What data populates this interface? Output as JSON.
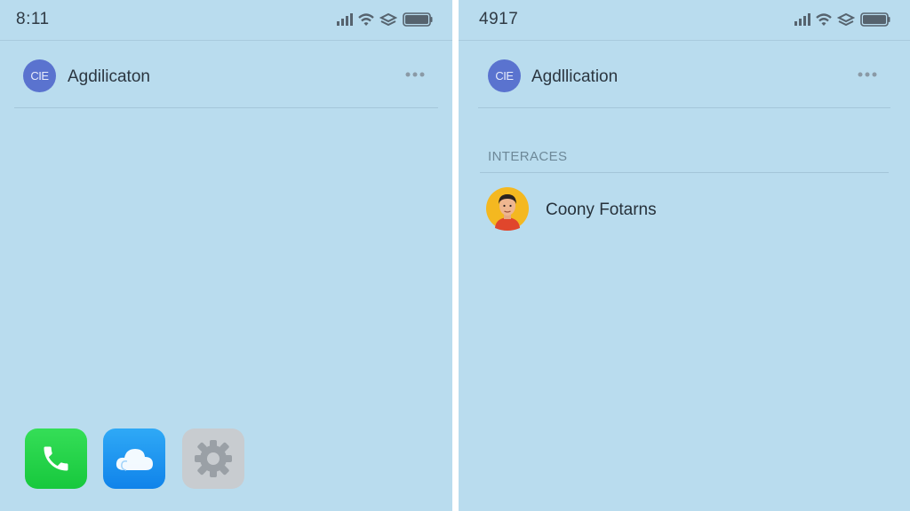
{
  "left_screen": {
    "status": {
      "time": "8:11"
    },
    "header": {
      "badge": "CIE",
      "title": "Agdilicaton"
    },
    "dock": [
      {
        "name": "phone",
        "icon": "phone-icon"
      },
      {
        "name": "cloud",
        "icon": "cloud-icon"
      },
      {
        "name": "settings",
        "icon": "gear-icon"
      }
    ]
  },
  "right_screen": {
    "status": {
      "time": "4917"
    },
    "header": {
      "badge": "CIE",
      "title": "Agdllication"
    },
    "section": {
      "label": "INTERACES"
    },
    "contacts": [
      {
        "name": "Coony Fotarns",
        "avatar": "person-avatar"
      }
    ]
  },
  "colors": {
    "background": "#b9dcee",
    "badge": "#5a73cf",
    "phone_app": "#21d048",
    "cloud_app": "#1a93f0",
    "settings_app": "#c8ccd0"
  }
}
